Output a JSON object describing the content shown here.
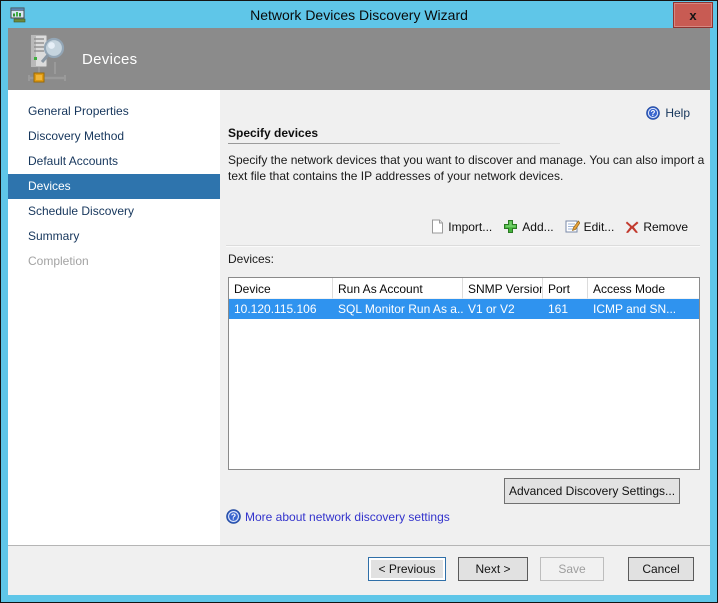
{
  "window": {
    "title": "Network Devices Discovery Wizard",
    "close_label": "x"
  },
  "header": {
    "title": "Devices"
  },
  "sidebar": {
    "items": [
      {
        "label": "General Properties",
        "state": "normal"
      },
      {
        "label": "Discovery Method",
        "state": "normal"
      },
      {
        "label": "Default Accounts",
        "state": "normal"
      },
      {
        "label": "Devices",
        "state": "selected"
      },
      {
        "label": "Schedule Discovery",
        "state": "normal"
      },
      {
        "label": "Summary",
        "state": "normal"
      },
      {
        "label": "Completion",
        "state": "disabled"
      }
    ]
  },
  "content": {
    "help_label": "Help",
    "section_title": "Specify devices",
    "description": "Specify the network devices that you want to discover and manage. You can also import a text file that contains the IP addresses of your network devices.",
    "toolbar": {
      "import_label": "Import...",
      "add_label": "Add...",
      "edit_label": "Edit...",
      "remove_label": "Remove"
    },
    "devices_label": "Devices:",
    "table": {
      "columns": [
        "Device",
        "Run As Account",
        "SNMP Version",
        "Port",
        "Access Mode"
      ],
      "rows": [
        {
          "device": "10.120.115.106",
          "run_as_account": "SQL Monitor Run As a...",
          "snmp_version": "V1 or V2",
          "port": "161",
          "access_mode": "ICMP and SN...",
          "selected": true
        }
      ]
    },
    "advanced_button_label": "Advanced Discovery Settings...",
    "more_link_label": "More about network discovery settings"
  },
  "footer": {
    "previous_label": "< Previous",
    "next_label": "Next >",
    "save_label": "Save",
    "cancel_label": "Cancel"
  },
  "colors": {
    "titlebar_blue": "#5fc6e8",
    "header_gray": "#8b8b8b",
    "sidebar_selected_blue": "#2e74ad",
    "row_selected_blue": "#2f93ef",
    "link_blue": "#3333cc",
    "close_red": "#c85b53"
  }
}
